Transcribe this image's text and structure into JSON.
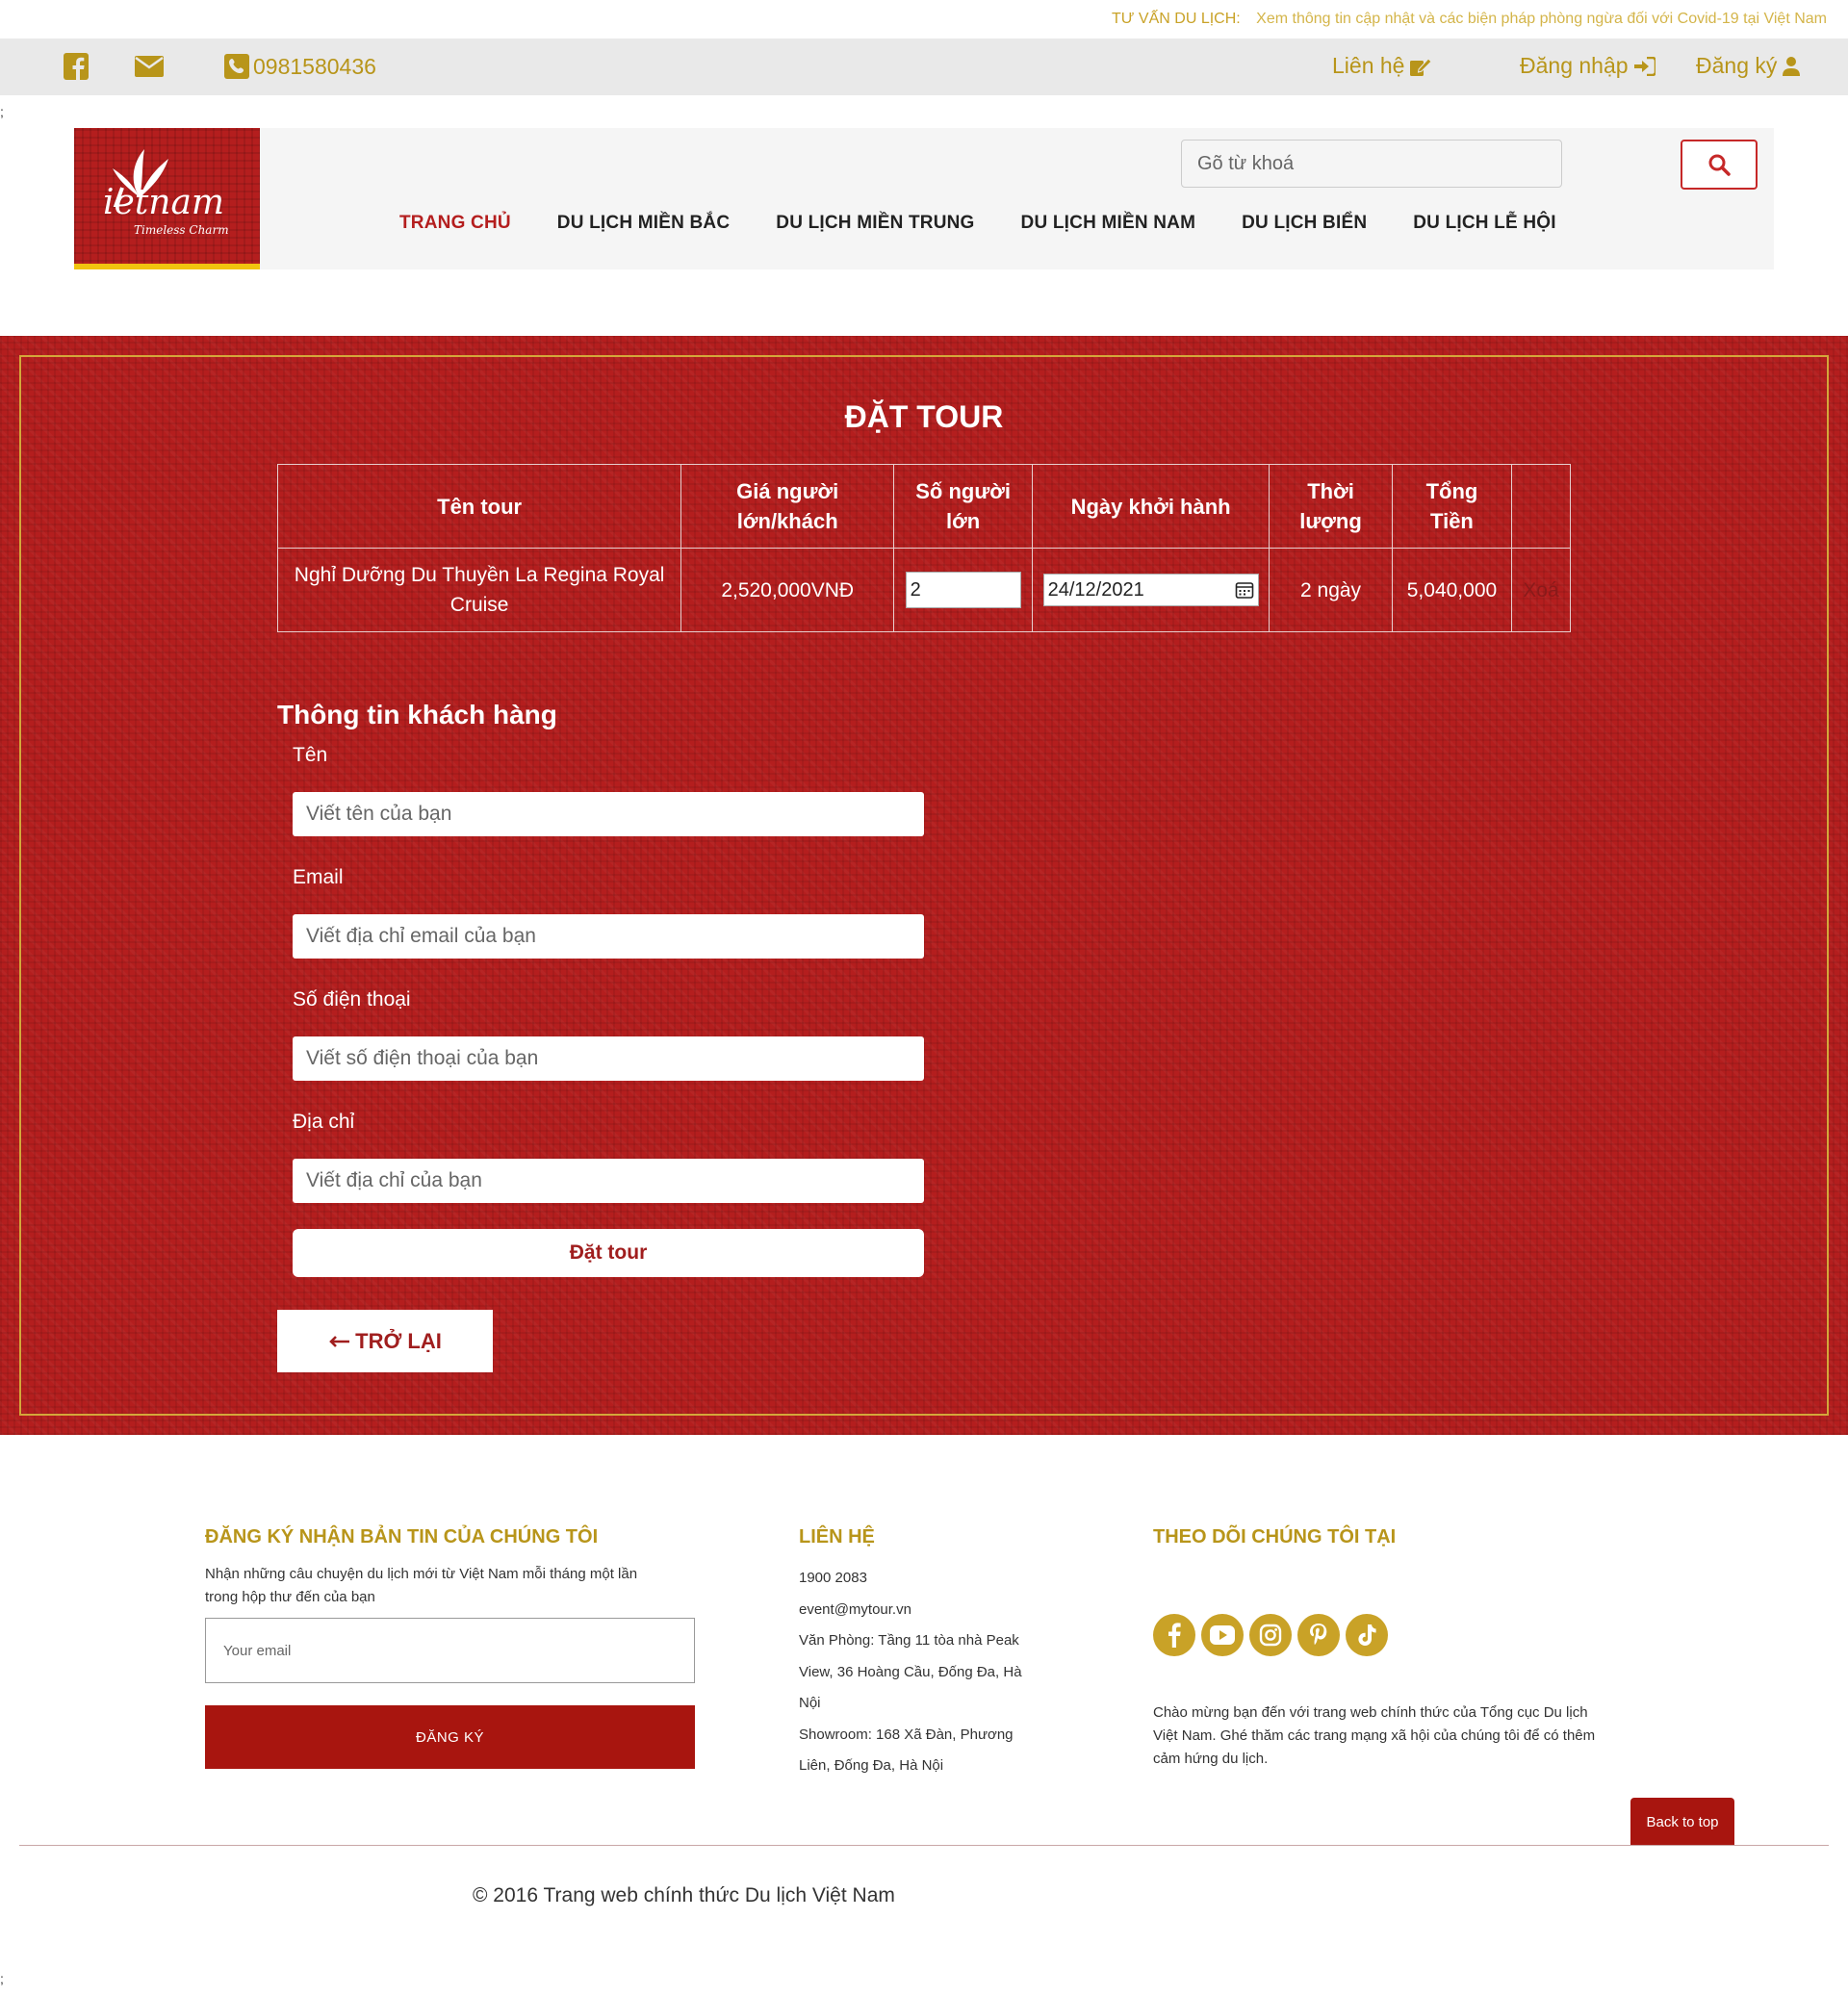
{
  "notice": {
    "label": "TƯ VẤN DU LỊCH:",
    "text": "Xem thông tin cập nhật và các biện pháp phòng ngừa đối với Covid-19 tại Việt Nam"
  },
  "utility": {
    "phone": "0981580436",
    "contact": "Liên hệ",
    "login": "Đăng nhập",
    "register": "Đăng ký"
  },
  "stray_top": ";",
  "stray_bottom": ";",
  "logo": {
    "main": "ietnam",
    "sub": "Timeless Charm"
  },
  "search": {
    "placeholder": "Gõ từ khoá"
  },
  "nav": [
    "TRANG CHỦ",
    "DU LỊCH MIỀN BẮC",
    "DU LỊCH MIỀN TRUNG",
    "DU LỊCH MIỀN NAM",
    "DU LỊCH BIỂN",
    "DU LỊCH LỄ HỘI"
  ],
  "booking": {
    "title": "ĐẶT TOUR",
    "headers": [
      "Tên tour",
      "Giá người lớn/khách",
      "Số người lớn",
      "Ngày khởi hành",
      "Thời lượng",
      "Tổng Tiền",
      ""
    ],
    "row": {
      "name": "Nghỉ Dưỡng Du Thuyền La Regina Royal Cruise",
      "price": "2,520,000VNĐ",
      "qty": "2",
      "date": "24/12/2021",
      "duration": "2 ngày",
      "total": "5,040,000",
      "delete": "Xoá"
    }
  },
  "customer": {
    "title": "Thông tin khách hàng",
    "name_label": "Tên",
    "name_placeholder": "Viết tên của bạn",
    "email_label": "Email",
    "email_placeholder": "Viết địa chỉ email của bạn",
    "phone_label": "Số điện thoại",
    "phone_placeholder": "Viết số điện thoại của bạn",
    "address_label": "Địa chỉ",
    "address_placeholder": "Viết địa chỉ của bạn",
    "submit": "Đặt tour",
    "back": "TRỞ LẠI"
  },
  "footer": {
    "newsletter_title": "ĐĂNG KÝ NHẬN BẢN TIN CỦA CHÚNG TÔI",
    "newsletter_text_1": "Nhận những câu chuyện du lịch mới từ Việt Nam mỗi tháng một lần",
    "newsletter_text_2": "trong hộp thư đến của bạn",
    "newsletter_placeholder": "Your email",
    "newsletter_button": "ĐĂNG KÝ",
    "contact_title": "LIÊN HỆ",
    "contact_lines": [
      "1900 2083",
      "event@mytour.vn",
      "Văn Phòng: Tầng 11 tòa nhà Peak",
      "View, 36 Hoàng Cầu, Đống Đa, Hà",
      "Nội",
      "Showroom: 168 Xã Đàn, Phương",
      "Liên, Đống Đa, Hà Nội"
    ],
    "follow_title": "THEO DÕI CHÚNG TÔI TẠI",
    "socials": [
      "facebook",
      "youtube",
      "instagram",
      "pinterest",
      "tiktok"
    ],
    "follow_text_1": "Chào mừng bạn đến với trang web chính thức của Tổng cục Du lịch",
    "follow_text_2": "Việt Nam. Ghé thăm các trang mạng xã hội của chúng tôi để có thêm",
    "follow_text_3": "cảm hứng du lịch.",
    "back_to_top": "Back to top",
    "copyright": "© 2016 Trang web chính thức Du lịch Việt Nam"
  },
  "colors": {
    "brand_red": "#b41e1e",
    "gold": "#c9a227",
    "button_red": "#a8150f"
  }
}
